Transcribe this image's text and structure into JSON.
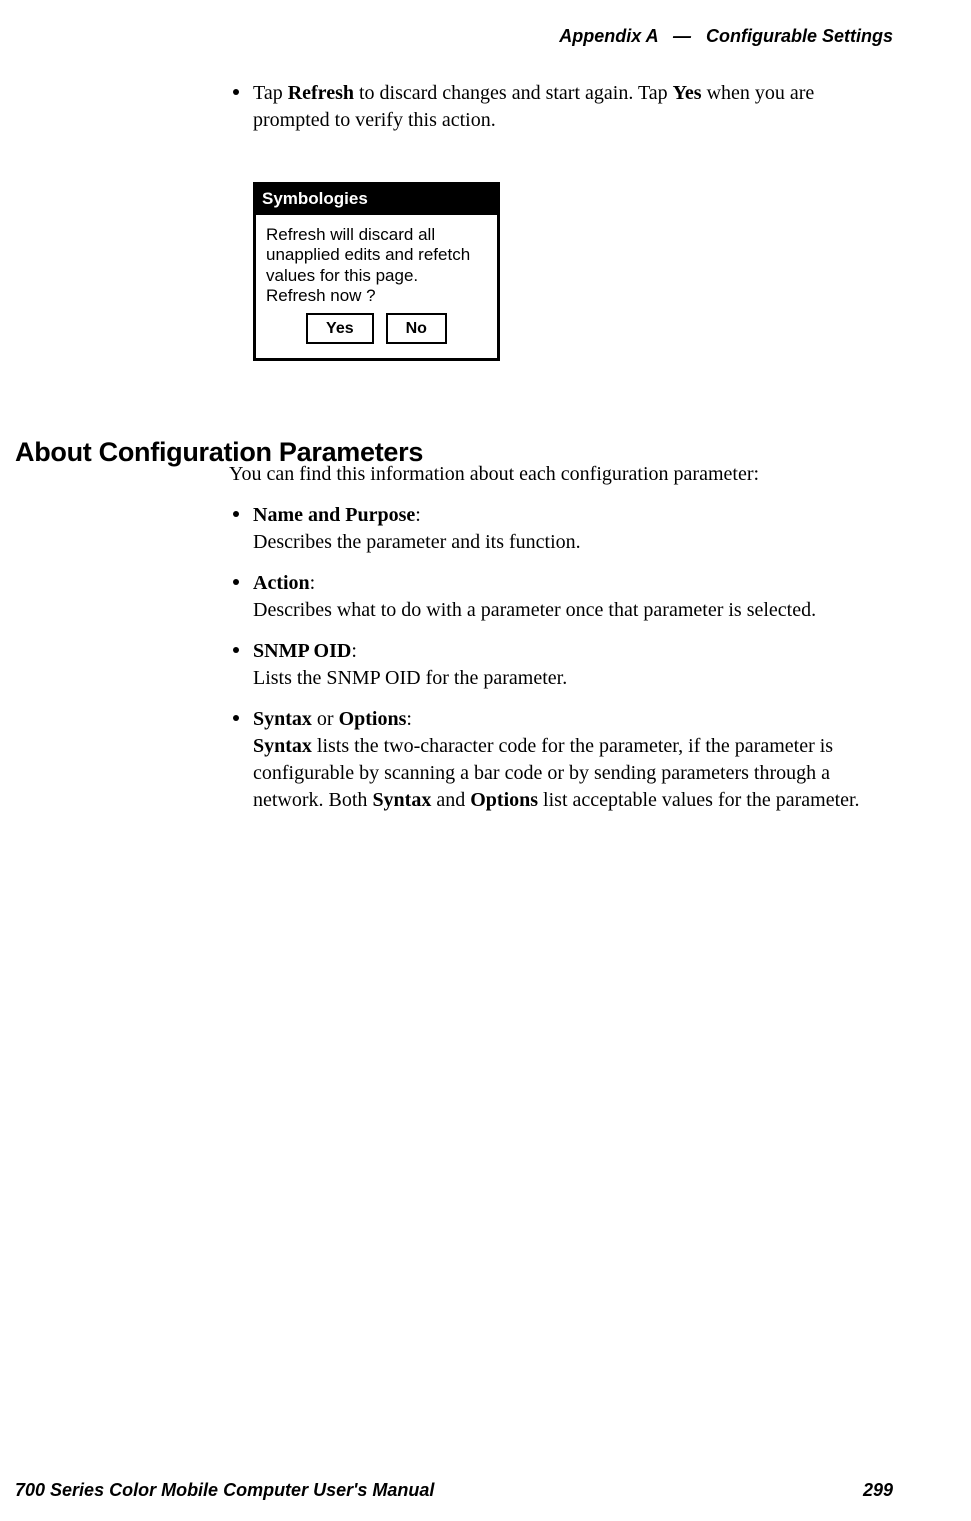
{
  "header": {
    "appendix": "Appendix A",
    "dash": "—",
    "title": "Configurable Settings"
  },
  "top_bullet": {
    "pre": "Tap ",
    "b1": "Refresh",
    "mid": " to discard changes and start again. Tap ",
    "b2": "Yes",
    "post": " when you are prompted to verify this action."
  },
  "dialog": {
    "title": "Symbologies",
    "line1": "Refresh will discard all",
    "line2": "unapplied edits and refetch",
    "line3": "values for this page.",
    "line4": "Refresh now ?",
    "yes": "Yes",
    "no": "No"
  },
  "section": {
    "heading": "About Configuration Parameters",
    "intro": "You can find this information about each configuration parameter:",
    "items": [
      {
        "label": "Name and Purpose",
        "colon": ":",
        "desc": "Describes the parameter and its function."
      },
      {
        "label": "Action",
        "colon": ":",
        "desc": "Describes what to do with a parameter once that parameter is selected."
      },
      {
        "label": "SNMP OID",
        "colon": ":",
        "desc": "Lists the SNMP OID for the parameter."
      }
    ],
    "item4": {
      "label1": "Syntax",
      "or": " or ",
      "label2": "Options",
      "colon": ":",
      "desc_b1": "Syntax",
      "desc_mid1": " lists the two-character code for the parameter, if the parameter is configurable by scanning a bar code or by sending parameters through a network. Both ",
      "desc_b2": "Syntax",
      "desc_mid2": " and ",
      "desc_b3": "Options",
      "desc_end": " list acceptable values for the para­meter."
    }
  },
  "footer": {
    "left": "700 Series Color Mobile Computer User's Manual",
    "right": "299"
  }
}
